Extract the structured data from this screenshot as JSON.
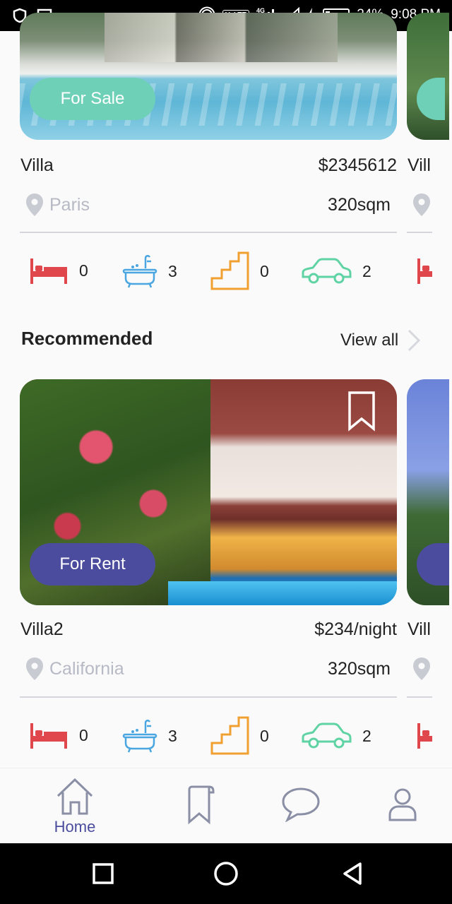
{
  "status_bar": {
    "battery": "24%",
    "time": "9:08 PM",
    "network": "VoLTE",
    "signal_label": "4G"
  },
  "listings_top": [
    {
      "badge": "For Sale",
      "title": "Villa",
      "price": "$2345612",
      "location": "Paris",
      "area": "320sqm",
      "beds": "0",
      "baths": "3",
      "floors": "0",
      "parking": "2"
    },
    {
      "title": "Vill"
    }
  ],
  "recommended": {
    "heading": "Recommended",
    "view_all": "View all",
    "items": [
      {
        "badge": "For Rent",
        "title": "Villa2",
        "price": "$234/night",
        "location": "California",
        "area": "320sqm",
        "beds": "0",
        "baths": "3",
        "floors": "0",
        "parking": "2"
      },
      {
        "title": "Vill"
      }
    ]
  },
  "bottom_nav": {
    "items": [
      {
        "label": "Home",
        "icon": "home-icon",
        "active": true
      },
      {
        "label": "",
        "icon": "bookmark-icon"
      },
      {
        "label": "",
        "icon": "chat-icon"
      },
      {
        "label": "",
        "icon": "profile-icon"
      }
    ]
  },
  "colors": {
    "accent": "#4b4c9e",
    "sale_badge": "#6fd0b8",
    "rent_badge": "#4b4c9e",
    "bed": "#e0474c",
    "bath": "#4aa6e0",
    "stairs": "#f0a030",
    "car": "#5fd3a3",
    "muted_text": "#b7b9c4"
  }
}
